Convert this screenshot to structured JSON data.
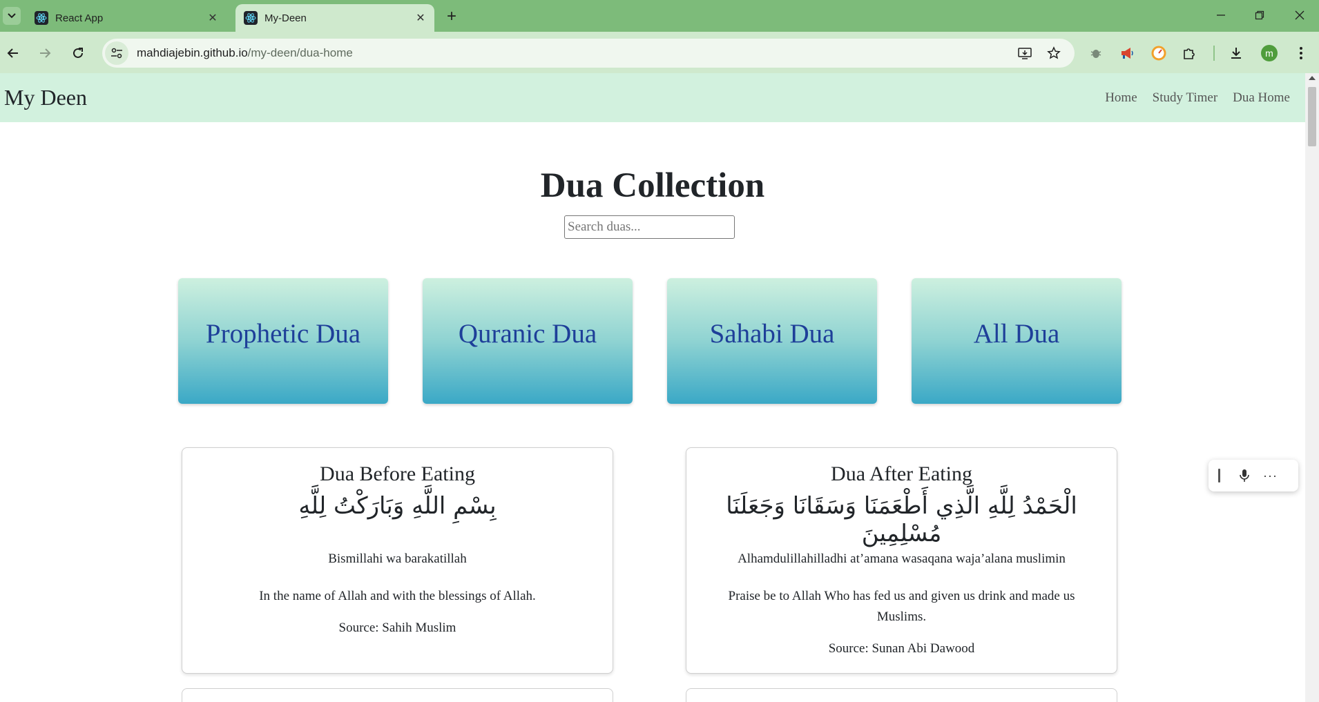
{
  "browser": {
    "tabs": [
      {
        "title": "React App",
        "active": false
      },
      {
        "title": "My-Deen",
        "active": true
      }
    ],
    "url_host": "mahdiajebin.github.io",
    "url_path": "/my-deen/dua-home",
    "profile_initial": "m",
    "icons": {
      "tab_list": "chevron-down-icon",
      "favicon": "react-icon",
      "close": "close-icon",
      "new_tab": "plus-icon",
      "back": "back-arrow-icon",
      "forward": "forward-arrow-icon",
      "reload": "reload-icon",
      "site_info": "site-info-icon",
      "install": "install-app-icon",
      "bookmark": "star-icon",
      "extensions": [
        "bug-icon",
        "megaphone-icon",
        "gauge-icon",
        "puzzle-icon"
      ],
      "downloads": "download-icon",
      "menu": "kebab-menu-icon"
    },
    "colors": {
      "frame": "#7dbb7a",
      "toolbar": "#cfe9cd"
    }
  },
  "navbar": {
    "brand": "My Deen",
    "links": [
      "Home",
      "Study Timer",
      "Dua Home"
    ]
  },
  "main": {
    "title": "Dua Collection",
    "search_placeholder": "Search duas...",
    "categories": [
      "Prophetic Dua",
      "Quranic Dua",
      "Sahabi Dua",
      "All Dua"
    ]
  },
  "duas": [
    {
      "title": "Dua Before Eating",
      "arabic": "بِسْمِ اللَّهِ وَبَارَكْتُ لِلَّهِ",
      "transliteration": "Bismillahi wa barakatillah",
      "translation": "In the name of Allah and with the blessings of Allah.",
      "source": "Source: Sahih Muslim"
    },
    {
      "title": "Dua After Eating",
      "arabic": "الْحَمْدُ لِلَّهِ الَّذِي أَطْعَمَنَا وَسَقَانَا وَجَعَلَنَا مُسْلِمِينَ",
      "transliteration": "Alhamdulillahilladhi at’amana wasaqana waja’alana muslimin",
      "translation": "Praise be to Allah Who has fed us and given us drink and made us Muslims.",
      "source": "Source: Sunan Abi Dawood"
    }
  ],
  "voice_widget": {
    "icons": [
      "drag-handle-icon",
      "microphone-icon",
      "more-options-icon"
    ],
    "more_label": "···"
  },
  "theme": {
    "navbar_bg": "#d2f1de",
    "category_text": "#1e3f99",
    "category_gradient_top": "#cdf0df",
    "category_gradient_bottom": "#3aa8c6"
  }
}
